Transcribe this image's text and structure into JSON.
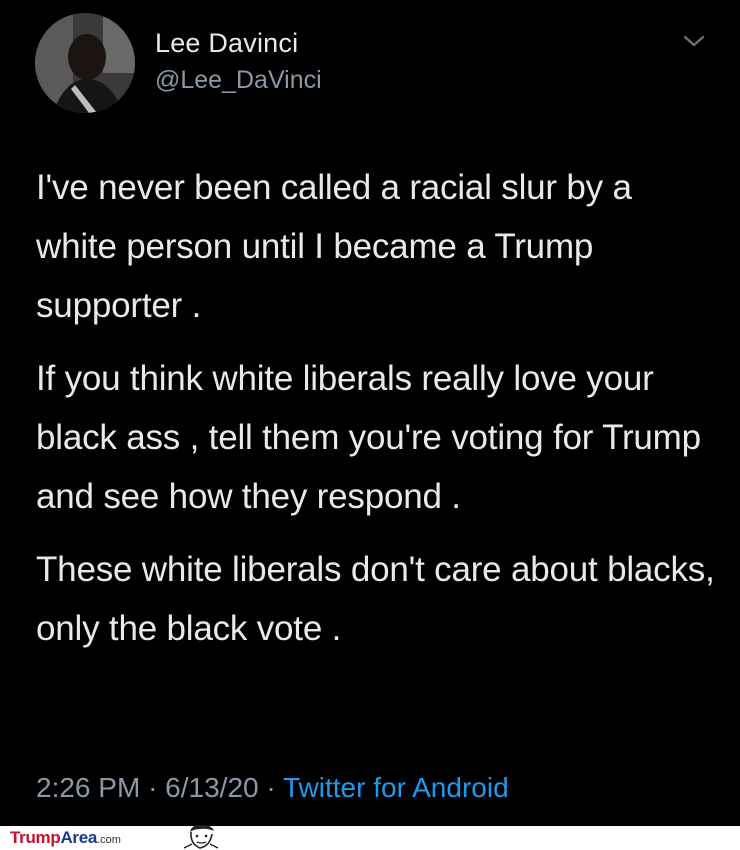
{
  "tweet": {
    "author_name": "Lee Davinci",
    "author_handle": "@Lee_DaVinci",
    "paragraphs": [
      "I've never been called a racial slur by a white person until I became a Trump supporter  .",
      "If you think white liberals really love your black ass , tell them you're voting for Trump and see how they respond .",
      "These white liberals don't care about blacks, only the black vote ."
    ],
    "time": "2:26 PM",
    "date": "6/13/20",
    "separator": "·",
    "source": "Twitter for Android"
  },
  "icons": {
    "avatar": "avatar-photo",
    "menu": "chevron-down-icon",
    "watermark_face": "cartoon-face-icon"
  },
  "watermark": {
    "part1": "Trump",
    "part2": "Area",
    "part3": ".com"
  },
  "colors": {
    "background": "#000000",
    "text": "#e7e9ea",
    "secondary": "#8b98a5",
    "link": "#1d9bf0",
    "watermark_red": "#c8102e",
    "watermark_blue": "#1a3a8a"
  }
}
